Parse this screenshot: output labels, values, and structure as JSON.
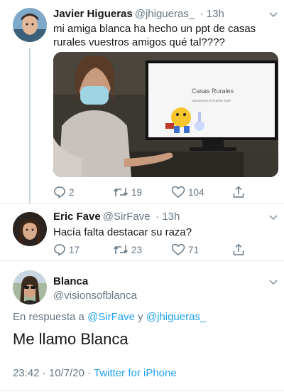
{
  "tweet1": {
    "name": "Javier Higueras",
    "handle": "@jhigueras_",
    "time": "· 13h",
    "text_line1": "mi amiga blanca ha hecho un ppt de casas",
    "text_line2": "rurales vuestros amigos qué tal????",
    "slide_title": "Casas Rurales",
    "slide_subtitle": "Vacaciones El Puente 2020",
    "replies": "2",
    "retweets": "19",
    "likes": "104"
  },
  "tweet2": {
    "name": "Eric Fave",
    "handle": "@SirFave",
    "time": "· 13h",
    "text": "Hacía falta destacar su raza?",
    "replies": "17",
    "retweets": "23",
    "likes": "71"
  },
  "tweet3": {
    "name": "Blanca",
    "handle": "@visionsofblanca",
    "reply_prefix": "En respuesta a",
    "reply_user1": "@SirFave",
    "reply_and": "y",
    "reply_user2": "@jhigueras_",
    "text": "Me llamo Blanca",
    "timestamp": "23:42 · 10/7/20 ·",
    "client": "Twitter for iPhone"
  },
  "colors": {
    "link": "#1da1f2",
    "secondary": "#657786",
    "primary": "#14171a",
    "divider": "#e6ecf0"
  }
}
